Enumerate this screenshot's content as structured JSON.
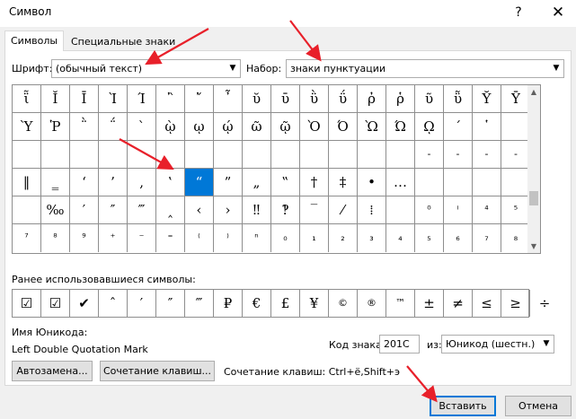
{
  "window": {
    "title": "Символ",
    "help": "?",
    "close": "✕"
  },
  "tabs": [
    {
      "label": "Символы"
    },
    {
      "label": "Специальные знаки"
    }
  ],
  "font": {
    "label": "Шрифт:",
    "value": "(обычный текст)"
  },
  "subset": {
    "label": "Набор:",
    "value": "знаки пунктуации"
  },
  "grid": {
    "rows": [
      [
        "ῗ",
        "Ῐ",
        "Ῑ",
        "Ὶ",
        "Ί",
        "῍",
        "῎",
        "῏",
        "ῠ",
        "ῡ",
        "ῢ",
        "ΰ",
        "ῤ",
        "ῥ",
        "ῦ",
        "ῧ",
        "Ῠ",
        "Ῡ"
      ],
      [
        "Ὺ",
        "Ῥ",
        "῭",
        "΅",
        "`",
        "ῲ",
        "ῳ",
        "ῴ",
        "ῶ",
        "ῷ",
        "Ὸ",
        "Ό",
        "Ὼ",
        "Ώ",
        "ῼ",
        "´",
        "῾",
        ""
      ],
      [
        "",
        "",
        "",
        "",
        "",
        "",
        "",
        "",
        "",
        "",
        "",
        "",
        "",
        "",
        "-",
        "-",
        "-",
        "-"
      ],
      [
        "‖",
        "‗",
        "‘",
        "’",
        "‚",
        "‛",
        "“",
        "”",
        "„",
        "‟",
        "†",
        "‡",
        "•",
        "…",
        "",
        "",
        "",
        ""
      ],
      [
        "",
        "‰",
        "′",
        "″",
        "‴",
        "‸",
        "‹",
        "›",
        "‼",
        "‽",
        "‾",
        "⁄",
        "⁞",
        "",
        "⁰",
        "ⁱ",
        "⁴",
        "⁵"
      ],
      [
        "⁷",
        "⁸",
        "⁹",
        "⁺",
        "⁻",
        "⁼",
        "⁽",
        "⁾",
        "ⁿ",
        "₀",
        "₁",
        "₂",
        "₃",
        "₄",
        "₅",
        "₆",
        "₇",
        "₈"
      ]
    ],
    "selected": "“"
  },
  "recent": {
    "label": "Ранее использовавшиеся символы:",
    "symbols": [
      "☑",
      "☑",
      "✔",
      "ˆ",
      "′",
      "″",
      "‴",
      "₽",
      "€",
      "£",
      "¥",
      "©",
      "®",
      "™",
      "±",
      "≠",
      "≤",
      "≥",
      "÷"
    ]
  },
  "unicode_name": {
    "label": "Имя Юникода:",
    "value": "Left Double Quotation Mark"
  },
  "code": {
    "label": "Код знака:",
    "value": "201C"
  },
  "from": {
    "label": "из:",
    "value": "Юникод (шестн.)"
  },
  "buttons": {
    "autocorrect": "Автозамена...",
    "shortcut": "Сочетание клавиш...",
    "insert": "Вставить",
    "cancel": "Отмена"
  },
  "shortcut_text": "Сочетание клавиш: Ctrl+ё,Shift+э",
  "colors": {
    "accent": "#0078d7",
    "annotation_arrow": "#e8202a"
  }
}
